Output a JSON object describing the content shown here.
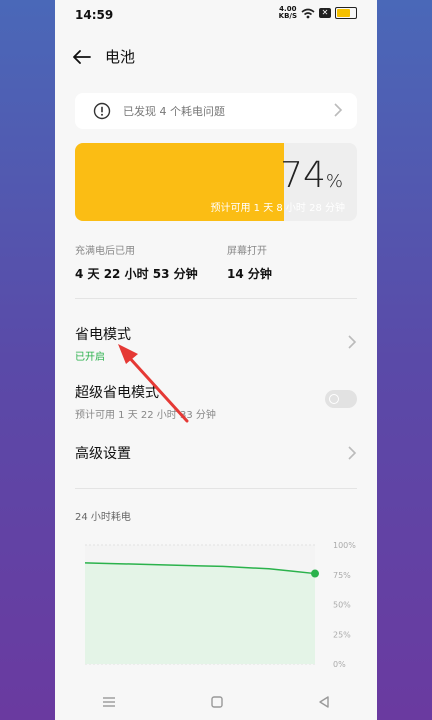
{
  "status_bar": {
    "time": "14:59",
    "net_speed_value": "4.00",
    "net_speed_unit": "KB/S",
    "battery_level": 0.74
  },
  "header": {
    "title": "电池"
  },
  "issue_banner": {
    "text": "已发现 4 个耗电问题"
  },
  "battery": {
    "percent_number": "74",
    "percent_sign": "%",
    "estimate": "预计可用 1 天 8 小时 28 分钟",
    "fill_color": "#fbbd14"
  },
  "stats": [
    {
      "label": "充满电后已用",
      "value": "4 天 22 小时 53 分钟"
    },
    {
      "label": "屏幕打开",
      "value": "14 分钟"
    }
  ],
  "settings": {
    "power_saving": {
      "title": "省电模式",
      "status": "已开启",
      "status_color": "#2bb24c"
    },
    "super_power_saving": {
      "title": "超级省电模式",
      "subtitle": "预计可用 1 天 22 小时 33 分钟",
      "enabled": false
    },
    "advanced": {
      "title": "高级设置"
    }
  },
  "chart_title": "24 小时耗电",
  "chart_data": {
    "type": "area",
    "title": "24 小时耗电",
    "y_ticks": [
      "100%",
      "75%",
      "50%",
      "25%",
      "0%"
    ],
    "ylim": [
      0,
      100
    ],
    "x": [
      0,
      0.1,
      0.2,
      0.3,
      0.4,
      0.5,
      0.6,
      0.7,
      0.8,
      0.9,
      1.0
    ],
    "values": [
      85,
      84.5,
      84,
      83.5,
      83,
      82.5,
      82,
      81,
      80,
      78,
      76
    ],
    "line_color": "#2bb24c",
    "fill_color": "#e4f4e7"
  }
}
